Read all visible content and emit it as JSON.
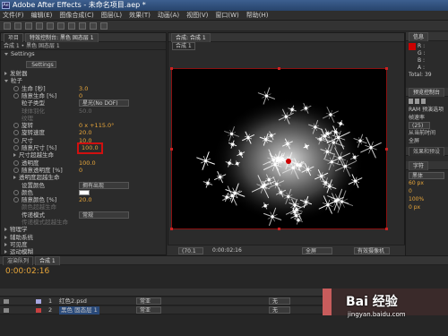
{
  "app": {
    "title": "Adobe After Effects - 未命名项目.aep *",
    "logo_text": "Ae"
  },
  "menu": [
    "文件(F)",
    "编辑(E)",
    "图像合成(C)",
    "图层(L)",
    "效果(T)",
    "动画(A)",
    "视图(V)",
    "窗口(W)",
    "帮助(H)"
  ],
  "left_panel": {
    "tabs": [
      "项目",
      "特效控制台: 黑色 固态层 1"
    ],
    "breadcrumb": "合成 1 • 黑色 固态层 1",
    "settings_group": "Settings",
    "settings_button": "Settings",
    "rows": [
      {
        "label": "发射器",
        "indent": 1,
        "value": "",
        "expanded": false
      },
      {
        "label": "粒子",
        "indent": 1,
        "value": "",
        "expanded": true
      },
      {
        "label": "生命 [秒]",
        "indent": 2,
        "value": "3.0",
        "swatch": true
      },
      {
        "label": "随意生命 [%]",
        "indent": 2,
        "value": "0",
        "swatch": true
      },
      {
        "label": "粒子类型",
        "indent": 2,
        "value": "",
        "dropdown": "星光(No DOF)"
      },
      {
        "label": "球体羽化",
        "indent": 2,
        "value": "50.0",
        "dim": true
      },
      {
        "label": "纹理",
        "indent": 2,
        "value": "",
        "dim": true
      },
      {
        "label": "旋转",
        "indent": 2,
        "value": "0 x +115.0°",
        "swatch": true
      },
      {
        "label": "旋转速度",
        "indent": 2,
        "value": "20.0",
        "swatch": true
      },
      {
        "label": "尺寸",
        "indent": 2,
        "value": "10.0",
        "swatch": true
      },
      {
        "label": "随意尺寸 [%]",
        "indent": 2,
        "value": "100.0",
        "swatch": true,
        "highlight": true
      },
      {
        "label": "尺寸超越生命",
        "indent": 2,
        "value": "",
        "expanded": false
      },
      {
        "label": "透明度",
        "indent": 2,
        "value": "100.0",
        "swatch": true
      },
      {
        "label": "随意透明度 [%]",
        "indent": 2,
        "value": "0",
        "swatch": true
      },
      {
        "label": "透明度超越生命",
        "indent": 2,
        "value": "",
        "expanded": false
      },
      {
        "label": "设置颜色",
        "indent": 2,
        "value": "",
        "dropdown": "拥有出现"
      },
      {
        "label": "颜色",
        "indent": 2,
        "value": "",
        "color_swatch": true,
        "swatch": true
      },
      {
        "label": "随意颜色 [%]",
        "indent": 2,
        "value": "20.0",
        "swatch": true
      },
      {
        "label": "颜色超越生命",
        "indent": 2,
        "value": "",
        "dim": true
      },
      {
        "label": "传递模式",
        "indent": 2,
        "value": "",
        "dropdown": "常规"
      },
      {
        "label": "传递模式超越生命",
        "indent": 2,
        "value": "",
        "dim": true
      },
      {
        "label": "物理学",
        "indent": 1,
        "value": "",
        "expanded": false
      },
      {
        "label": "辅助系统",
        "indent": 1,
        "value": "",
        "expanded": false
      },
      {
        "label": "可见度",
        "indent": 1,
        "value": "",
        "expanded": false
      },
      {
        "label": "运动模糊",
        "indent": 1,
        "value": "",
        "expanded": false
      }
    ]
  },
  "viewer": {
    "tab": "合成: 合成 1",
    "sub_tab": "合成 1",
    "zoom": "(70.1",
    "timecode": "0:00:02:16",
    "view_mode": "全屏",
    "camera": "有效摄像机"
  },
  "right_panel": {
    "info_tab": "信息",
    "info_labels": [
      "R :",
      "G :",
      "B :",
      "A :"
    ],
    "total": "Total: 39",
    "preview_tab": "预览控制台",
    "ram_label": "RAM 预演选项",
    "frame_rate_label": "帧速率",
    "frame_rate": "(25)",
    "from_label": "从当前时间",
    "fullscreen": "全屏",
    "effects_tab": "效果和预设",
    "char_tab": "字符",
    "font": "黑体",
    "font_size": "60 px",
    "tracking": "0",
    "scale_v": "100%",
    "scale_h": "0 px"
  },
  "timeline": {
    "tabs": [
      "渲染队列",
      "合成 1"
    ],
    "timecode": "0:00:02:16",
    "layers": [
      {
        "num": "1",
        "name": "红色2.psd",
        "mode": "常亚",
        "parent": "无"
      },
      {
        "num": "2",
        "name": "黑色 固态层 1",
        "mode": "常亚",
        "parent": "无"
      }
    ],
    "column_labels": [
      "无",
      "无"
    ]
  },
  "watermark": {
    "line1": "Bai 经验",
    "line2": "jingyan.baidu.com"
  },
  "colors": {
    "accent": "#e8a63a",
    "highlight": "#d01010",
    "title": "#2f4f7f"
  }
}
